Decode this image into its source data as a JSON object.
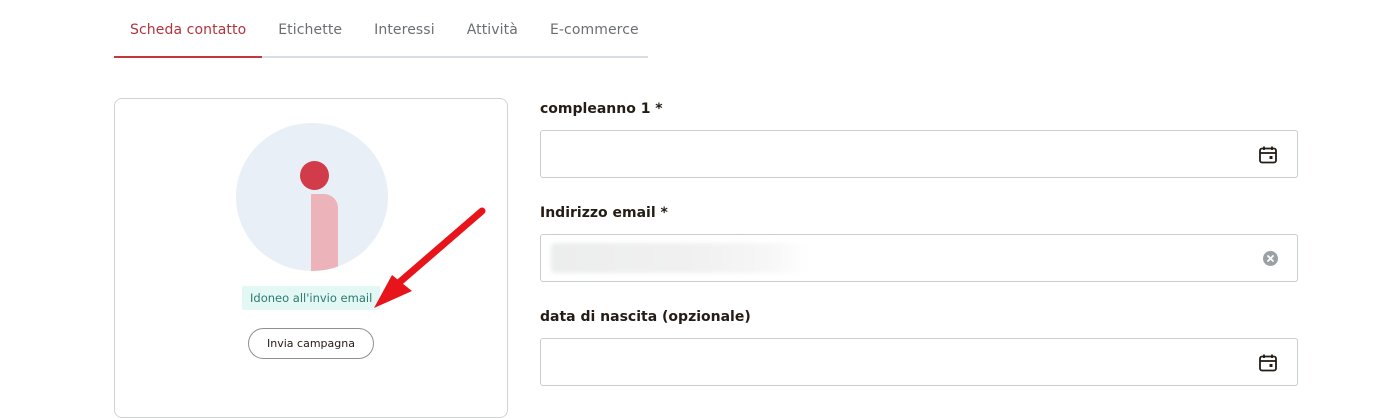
{
  "tabs": [
    {
      "label": "Scheda contatto",
      "active": true
    },
    {
      "label": "Etichette",
      "active": false
    },
    {
      "label": "Interessi",
      "active": false
    },
    {
      "label": "Attività",
      "active": false
    },
    {
      "label": "E-commerce",
      "active": false
    }
  ],
  "profile": {
    "badge": "Idoneo all'invio email",
    "send_button": "Invia campagna"
  },
  "form": {
    "birthday1": {
      "label": "compleanno 1 *",
      "value": "",
      "icon": "calendar-icon"
    },
    "email": {
      "label": "Indirizzo email *",
      "value": "",
      "icon": "clear-icon"
    },
    "birthdate": {
      "label": "data di nascita (opzionale)",
      "value": "",
      "icon": "calendar-icon"
    }
  },
  "colors": {
    "accent": "#c1393f",
    "badge_bg": "#e3f7f4",
    "badge_text": "#2d7a70",
    "annotation_arrow": "#e8141b"
  }
}
